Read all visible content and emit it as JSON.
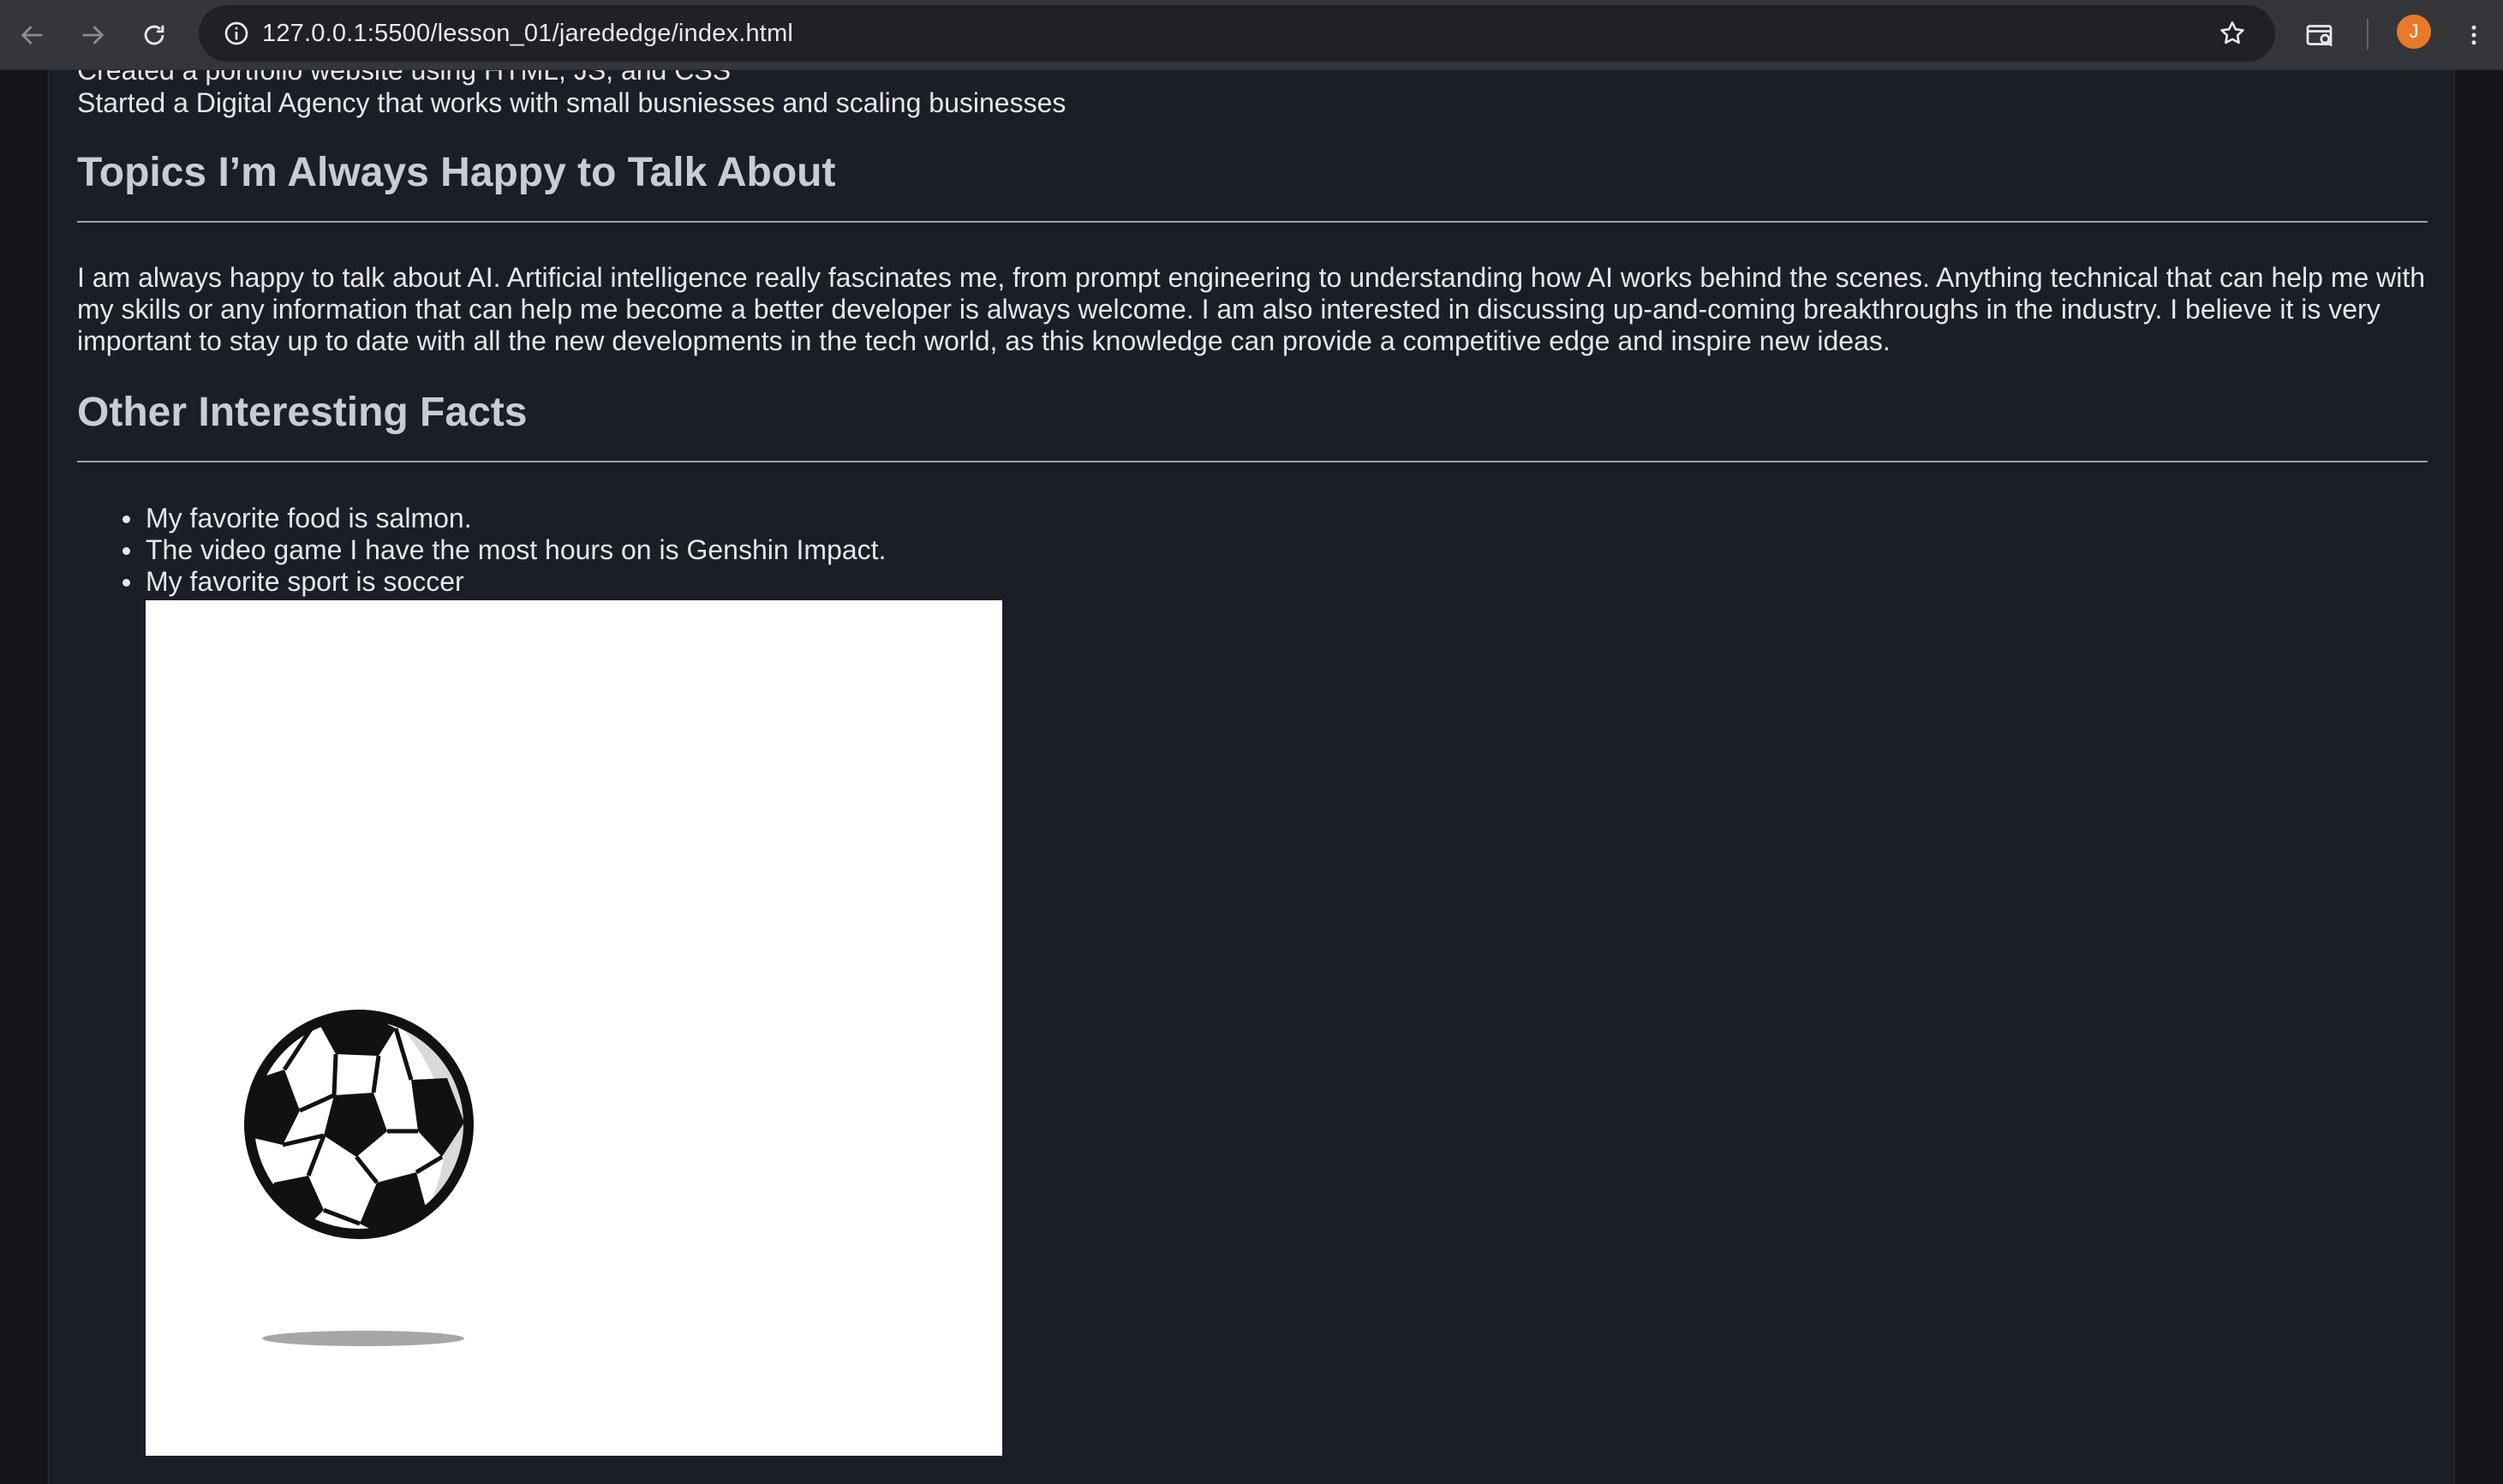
{
  "browser": {
    "url": "127.0.0.1:5500/lesson_01/jarededge/index.html",
    "avatar_initial": "J",
    "icons": [
      "back-arrow-icon",
      "forward-arrow-icon",
      "reload-icon",
      "info-icon",
      "star-icon",
      "search-tab-icon",
      "menu-dots-icon"
    ]
  },
  "page": {
    "clipped_line": "Created a portfolio website using HTML, JS, and CSS",
    "agency_line": "Started a Digital Agency that works with small busniesses and scaling businesses",
    "topics": {
      "heading": "Topics I’m Always Happy to Talk About",
      "paragraph": "I am always happy to talk about AI. Artificial intelligence really fascinates me, from prompt engineering to understanding how AI works behind the scenes. Anything technical that can help me with my skills or any information that can help me become a better developer is always welcome. I am also interested in discussing up-and-coming breakthroughs in the industry. I believe it is very important to stay up to date with all the new developments in the tech world, as this knowledge can provide a competitive edge and inspire new ideas."
    },
    "facts": {
      "heading": "Other Interesting Facts",
      "items": [
        "My favorite food is salmon.",
        "The video game I have the most hours on is Genshin Impact.",
        "My favorite sport is soccer"
      ]
    },
    "image": {
      "icon": "soccer-ball-icon"
    }
  },
  "colors": {
    "page_bg": "#1b1e27",
    "heading": "#c9ccd3",
    "text": "#e6e7ea",
    "chrome": "#35363a",
    "avatar": "#e8792b"
  }
}
